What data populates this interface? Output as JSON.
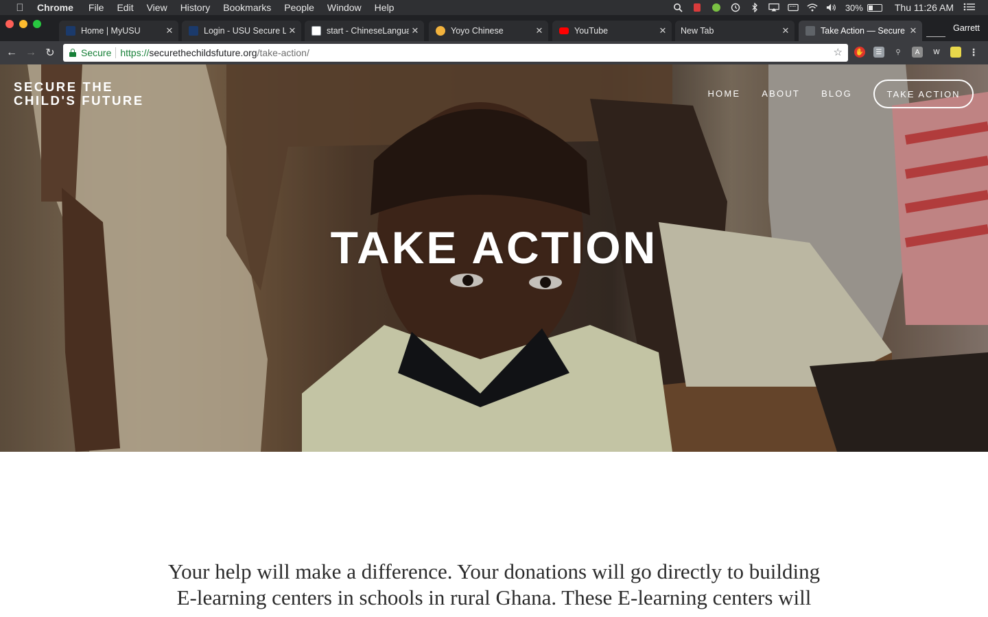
{
  "menubar": {
    "apple_icon": "apple-icon",
    "app_name": "Chrome",
    "menus": [
      "File",
      "Edit",
      "View",
      "History",
      "Bookmarks",
      "People",
      "Window",
      "Help"
    ],
    "battery_percent": "30%",
    "clock": "Thu 11:26 AM",
    "status_icons": [
      "spotlight-search-icon",
      "cardhop-icon",
      "evernote-icon",
      "time-machine-icon",
      "bluetooth-icon",
      "airplay-icon",
      "keyboard-icon",
      "wifi-icon",
      "volume-icon",
      "battery-icon",
      "notification-list-icon"
    ]
  },
  "tabs": [
    {
      "title": "Home | MyUSU",
      "active": false
    },
    {
      "title": "Login - USU Secure Login",
      "active": false
    },
    {
      "title": "start - ChineseLanguage",
      "active": false
    },
    {
      "title": "Yoyo Chinese",
      "active": false
    },
    {
      "title": "YouTube",
      "active": false
    },
    {
      "title": "New Tab",
      "active": false
    },
    {
      "title": "Take Action — Secure the Child's Future",
      "active": true
    }
  ],
  "profile_name": "Garrett",
  "omnibox": {
    "secure_label": "Secure",
    "url_scheme": "https://",
    "url_host": "securethechildsfuture.org",
    "url_path": "/take-action/"
  },
  "site": {
    "logo_line1": "SECURE THE",
    "logo_line2": "CHILD'S FUTURE",
    "nav": [
      "HOME",
      "ABOUT",
      "BLOG"
    ],
    "cta": "TAKE ACTION",
    "hero_title": "TAKE ACTION",
    "intro_lines": [
      "Your help will make a difference. Your donations will go directly to building",
      "E-learning centers in schools in rural Ghana. These E-learning centers will"
    ]
  },
  "colors": {
    "secure_green": "#188038",
    "tab_strip": "#202124",
    "toolbar": "#3b3c40",
    "menubar": "#2f3033"
  }
}
